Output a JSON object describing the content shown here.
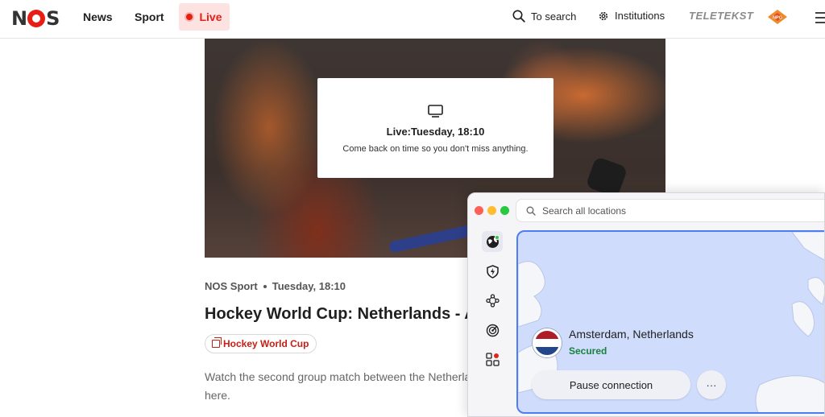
{
  "header": {
    "logo": "NOS",
    "nav": [
      {
        "label": "News"
      },
      {
        "label": "Sport"
      }
    ],
    "live_label": "Live",
    "search_label": "To search",
    "settings_label": "Institutions",
    "teletekst_label": "TELETEKST",
    "npo_label": "NPO"
  },
  "video": {
    "live_title": "Live:Tuesday, 18:10",
    "live_subtitle": "Come back on time so you don't miss anything."
  },
  "article": {
    "source": "NOS Sport",
    "time": "Tuesday, 18:10",
    "title": "Hockey World Cup: Netherlands - A",
    "tag": "Hockey World Cup",
    "body_line1": "Watch the second group match between the Netherla",
    "body_line2": "here."
  },
  "vpn": {
    "search_placeholder": "Search all locations",
    "location": "Amsterdam, Netherlands",
    "status": "Secured",
    "pause_label": "Pause connection",
    "more_label": "···",
    "colors": {
      "accent": "#4d7df2",
      "secured": "#17813e",
      "map": "#cfdcfb"
    }
  },
  "colors": {
    "brand_red": "#e61e14",
    "live_bg": "#fde2e2"
  }
}
